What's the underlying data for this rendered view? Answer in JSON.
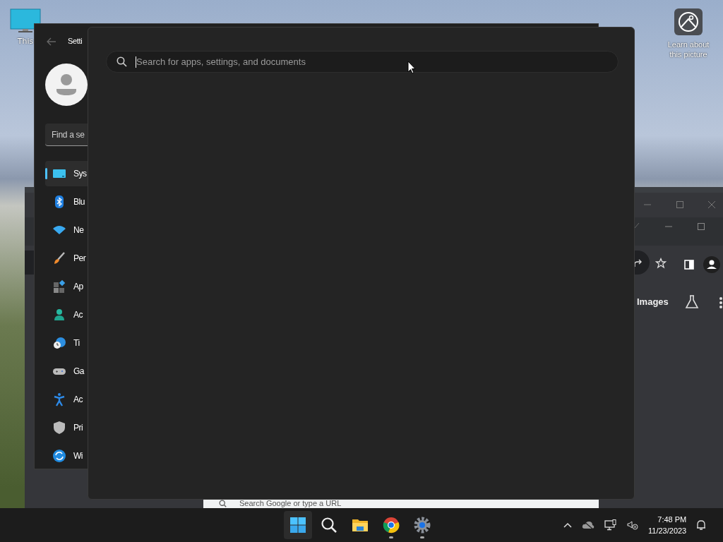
{
  "desktop": {
    "icons": [
      {
        "label": "This"
      }
    ],
    "spotlight": {
      "label": "Learn about this picture"
    }
  },
  "browser": {
    "tab_label": "Images",
    "address_placeholder": "Search Google or type a URL"
  },
  "settings": {
    "title": "Setti",
    "search_placeholder": "Find a se",
    "nav": [
      {
        "label": "Sys",
        "kind": "system",
        "selected": true
      },
      {
        "label": "Blu",
        "kind": "bluetooth",
        "selected": false
      },
      {
        "label": "Ne",
        "kind": "network",
        "selected": false
      },
      {
        "label": "Per",
        "kind": "brush",
        "selected": false
      },
      {
        "label": "Ap",
        "kind": "apps",
        "selected": false
      },
      {
        "label": "Ac",
        "kind": "accounts",
        "selected": false
      },
      {
        "label": "Ti",
        "kind": "time",
        "selected": false
      },
      {
        "label": "Ga",
        "kind": "gaming",
        "selected": false
      },
      {
        "label": "Ac",
        "kind": "accessibility",
        "selected": false
      },
      {
        "label": "Pri",
        "kind": "privacy",
        "selected": false
      },
      {
        "label": "Wi",
        "kind": "update",
        "selected": false
      }
    ]
  },
  "search_panel": {
    "placeholder": "Search for apps, settings, and documents"
  },
  "taskbar": {
    "apps": [
      {
        "kind": "start",
        "selected": true,
        "running": false
      },
      {
        "kind": "search",
        "selected": false,
        "running": false
      },
      {
        "kind": "files",
        "selected": false,
        "running": false
      },
      {
        "kind": "chrome",
        "selected": false,
        "running": true
      },
      {
        "kind": "settings",
        "selected": false,
        "running": true
      }
    ],
    "time": "7:48 PM",
    "date": "11/23/2023"
  }
}
